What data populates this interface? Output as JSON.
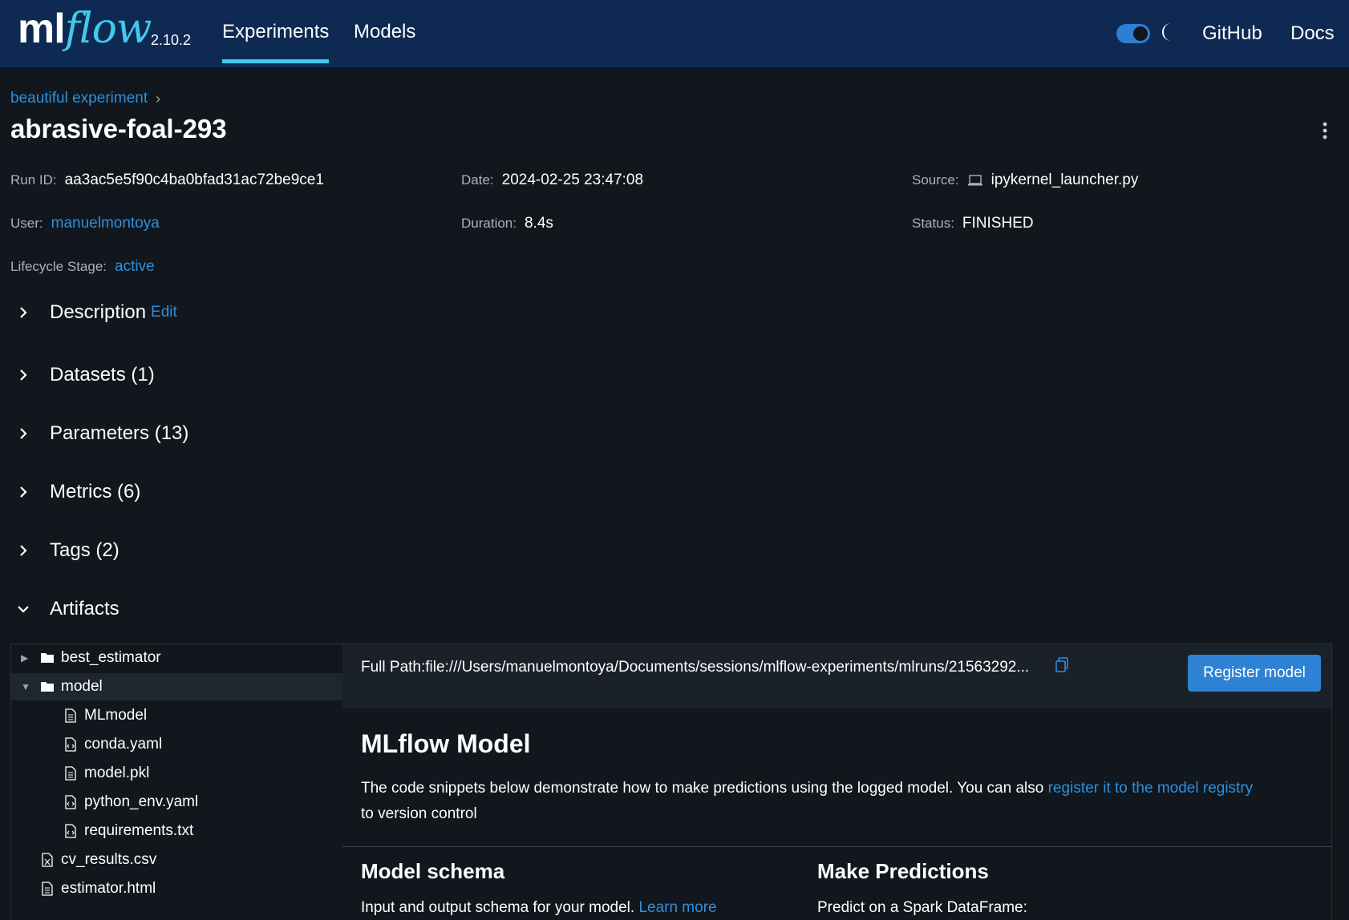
{
  "nav": {
    "logo_ml": "ml",
    "logo_flow": "flow",
    "version": "2.10.2",
    "tabs": [
      {
        "label": "Experiments",
        "active": true
      },
      {
        "label": "Models",
        "active": false
      }
    ],
    "links": [
      "GitHub",
      "Docs"
    ]
  },
  "breadcrumb": {
    "experiment": "beautiful experiment",
    "separator": "›"
  },
  "run_title": "abrasive-foal-293",
  "meta": {
    "run_id": {
      "key": "Run ID:",
      "value": "aa3ac5e5f90c4ba0bfad31ac72be9ce1"
    },
    "date": {
      "key": "Date:",
      "value": "2024-02-25 23:47:08"
    },
    "source": {
      "key": "Source:",
      "value": "ipykernel_launcher.py"
    },
    "user": {
      "key": "User:",
      "value": "manuelmontoya"
    },
    "duration": {
      "key": "Duration:",
      "value": "8.4s"
    },
    "status": {
      "key": "Status:",
      "value": "FINISHED"
    },
    "lifecycle": {
      "key": "Lifecycle Stage:",
      "value": "active"
    }
  },
  "sections": [
    {
      "label": "Description",
      "edit": "Edit",
      "expanded": false
    },
    {
      "label": "Datasets (1)",
      "expanded": false
    },
    {
      "label": "Parameters (13)",
      "expanded": false
    },
    {
      "label": "Metrics (6)",
      "expanded": false
    },
    {
      "label": "Tags (2)",
      "expanded": false
    },
    {
      "label": "Artifacts",
      "expanded": true
    }
  ],
  "artifacts": {
    "tree": [
      {
        "name": "best_estimator",
        "type": "folder",
        "expanded": false
      },
      {
        "name": "model",
        "type": "folder",
        "expanded": true,
        "selected": true
      },
      {
        "name": "MLmodel",
        "type": "file"
      },
      {
        "name": "conda.yaml",
        "type": "code-file"
      },
      {
        "name": "model.pkl",
        "type": "file"
      },
      {
        "name": "python_env.yaml",
        "type": "code-file"
      },
      {
        "name": "requirements.txt",
        "type": "code-file"
      },
      {
        "name": "cv_results.csv",
        "type": "spreadsheet-file"
      },
      {
        "name": "estimator.html",
        "type": "file"
      }
    ],
    "full_path": "Full Path:file:///Users/manuelmontoya/Documents/sessions/mlflow-experiments/mlruns/21563292...",
    "register_label": "Register model",
    "model_title": "MLflow Model",
    "model_desc": "The code snippets below demonstrate how to make predictions using the logged model. You can also",
    "model_desc_link": "register it to the model registry",
    "model_desc_end": "to version control",
    "schema_title": "Model schema",
    "schema_desc": "Input and output schema for your model.",
    "schema_link": "Learn more",
    "predict_title": "Make Predictions",
    "predict_desc": "Predict on a Spark DataFrame:"
  },
  "colors": {
    "nav_bg": "#0e2a52",
    "page_bg": "#11171c",
    "accent": "#43c9ed",
    "link": "#2d8fe0",
    "button": "#2d82d3"
  }
}
